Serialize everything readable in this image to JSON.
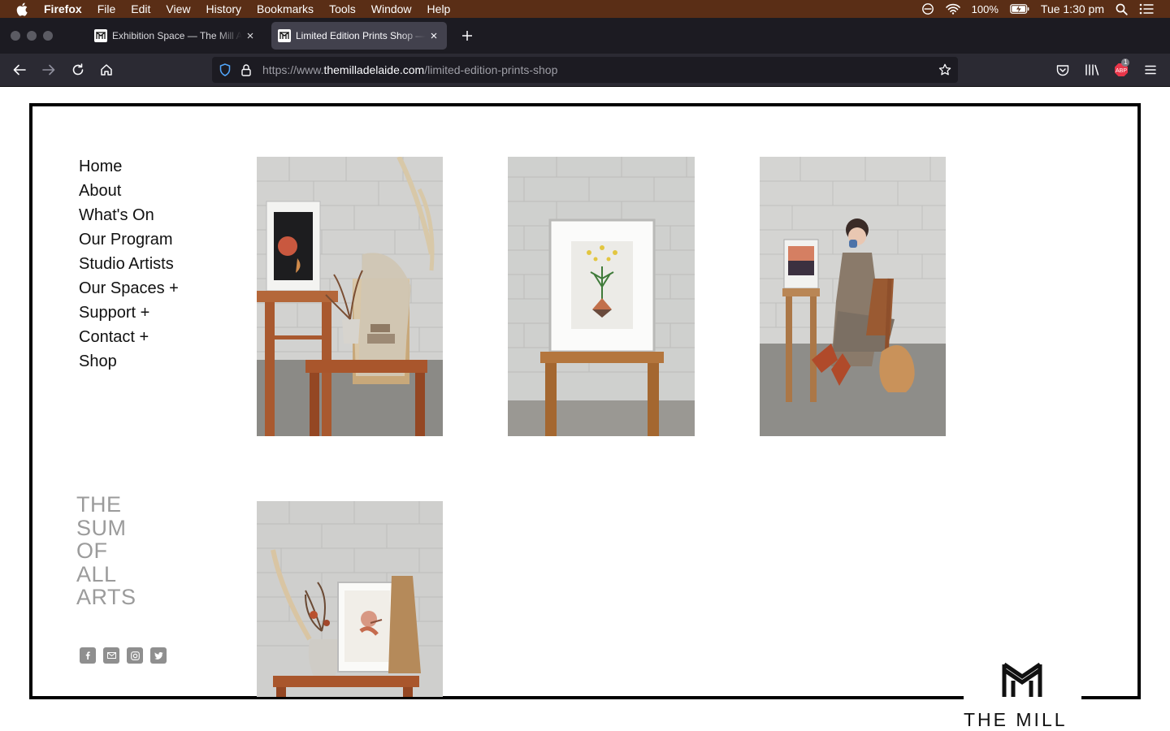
{
  "menubar": {
    "app_name": "Firefox",
    "items": [
      "File",
      "Edit",
      "View",
      "History",
      "Bookmarks",
      "Tools",
      "Window",
      "Help"
    ],
    "battery": "100%",
    "clock": "Tue 1:30 pm"
  },
  "tabs": [
    {
      "title": "Exhibition Space — The Mill Adelaide",
      "active": false
    },
    {
      "title": "Limited Edition Prints Shop — The Mill Adelaide",
      "active": true
    }
  ],
  "urlbar": {
    "prefix": "https://www.",
    "domain": "themilladelaide.com",
    "path": "/limited-edition-prints-shop"
  },
  "extension_badge": "1",
  "site": {
    "nav": [
      "Home",
      "About",
      "What's On",
      "Our Program",
      "Studio Artists",
      "Our Spaces +",
      "Support +",
      "Contact +",
      "Shop"
    ],
    "tagline": [
      "THE",
      "SUM",
      "OF",
      "ALL",
      "ARTS"
    ],
    "social_icons": [
      "facebook-icon",
      "email-icon",
      "instagram-icon",
      "twitter-icon"
    ],
    "logo_text": "THE MILL"
  },
  "colors": {
    "menubar": "#5a2e16",
    "tabstrip": "#1c1b22",
    "toolbar": "#2b2a33",
    "frame": "#000000",
    "tagline": "#9b9b9b"
  }
}
